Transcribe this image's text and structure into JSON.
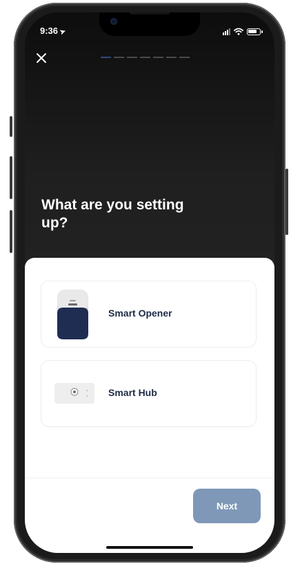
{
  "status_bar": {
    "time": "9:36"
  },
  "header": {
    "close_icon": "close-icon",
    "progress_steps": 7,
    "active_step": 1
  },
  "title": "What are you setting up?",
  "options": [
    {
      "label": "Smart Opener",
      "icon": "smart-opener-device-image"
    },
    {
      "label": "Smart Hub",
      "icon": "smart-hub-device-image"
    }
  ],
  "footer": {
    "next_label": "Next"
  },
  "colors": {
    "accent": "#2E4A78",
    "button_bg": "#7F98B8",
    "label_text": "#1E2A45"
  }
}
